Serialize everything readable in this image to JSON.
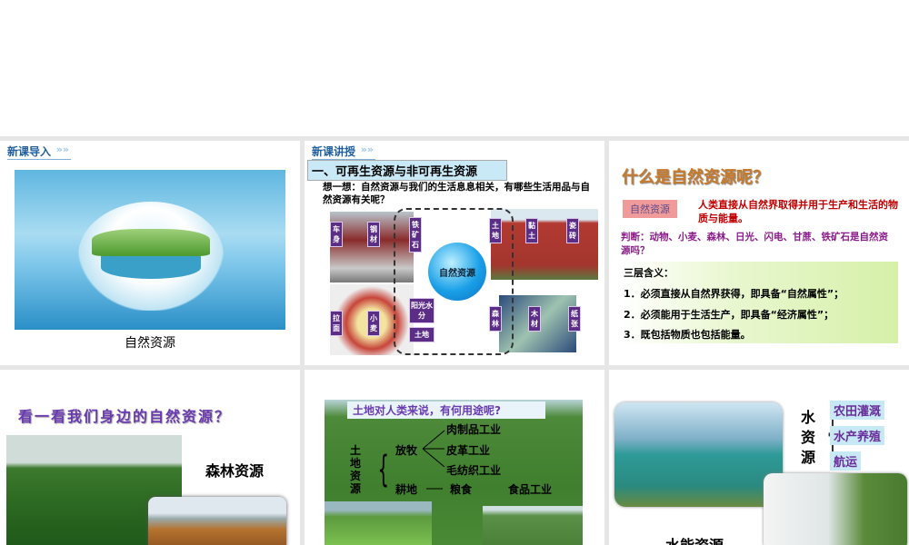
{
  "slides": [
    {
      "tag": "新课导入",
      "caption": "自然资源"
    },
    {
      "tag": "新课讲授",
      "heading": "一、可再生资源与非可再生资源",
      "question": "想一想：自然资源与我们的生活息息相关，有哪些生活用品与自然资源有关呢？",
      "center": "自然资源",
      "boxes": {
        "cheshen": "车身",
        "gangcai": "钢材",
        "tiekuang": "铁矿石",
        "tudi": "土地",
        "niantu": "黏土",
        "zhuan": "瓷砖",
        "lamian": "拉面",
        "xiaomai": "小麦",
        "yangguang": "阳光水分",
        "tudi2": "土地",
        "senlin": "森林",
        "mucai": "木材",
        "zhizhang": "纸张"
      }
    },
    {
      "title": "什么是自然资源呢？",
      "label": "自然资源",
      "definition": "人类直接从自然界取得并用于生产和生活的物质与能量。",
      "judge": "判断：动物、小麦、森林、日光、闪电、甘蔗、铁矿石是自然资源吗？",
      "meanings_title": "三层含义：",
      "meanings": [
        "1．必须直接从自然界获得，即具备“自然属性”；",
        "2．必须能用于生活生产，即具备“经济属性”；",
        "3．既包括物质也包括能量。"
      ]
    },
    {
      "title": "看一看我们身边的自然资源？",
      "caption": "森林资源"
    },
    {
      "title": "土地对人类来说，有何用途呢?",
      "root": "土地资源",
      "n1": "放牧",
      "n2": "耕地",
      "l1": "肉制品工业",
      "l2": "皮革工业",
      "l3": "毛纺织工业",
      "l4": "粮食",
      "l5": "食品工业"
    },
    {
      "root": "水资源",
      "uses": [
        "农田灌溉",
        "水产养殖",
        "航运"
      ],
      "caption": "水能资源"
    }
  ],
  "colors": {
    "gap": "#e6e6e6",
    "purple": "#5b2d86",
    "red": "#c00000",
    "link": "#1f5f9e"
  }
}
